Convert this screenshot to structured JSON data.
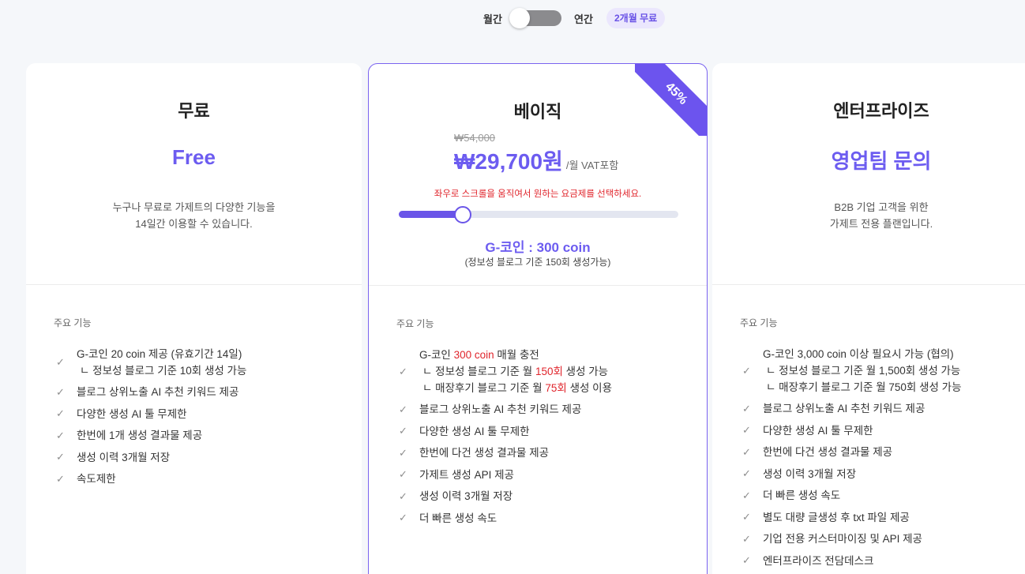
{
  "toggle": {
    "monthly_label": "월간",
    "yearly_label": "연간",
    "badge": "2개월 무료"
  },
  "plans": {
    "free": {
      "name": "무료",
      "price": "Free",
      "desc_line1": "누구나 무료로 가제트의 다양한 기능을",
      "desc_line2": "14일간 이용할 수 있습니다.",
      "features_title": "주요 기능",
      "features": [
        {
          "line1": "G-코인 20 coin 제공 (유효기간 14일)",
          "line2": "ㄴ 정보성 블로그 기준 10회 생성 가능"
        },
        {
          "text": "블로그 상위노출 AI 추천 키워드 제공"
        },
        {
          "text": "다양한 생성 AI 툴 무제한"
        },
        {
          "text": "한번에 1개 생성 결과물 제공"
        },
        {
          "text": "생성 이력 3개월 저장"
        },
        {
          "text": "속도제한"
        }
      ]
    },
    "basic": {
      "name": "베이직",
      "discount": "45%",
      "original_price": "₩54,000",
      "price": "₩29,700원",
      "unit": "/월 VAT포함",
      "hint": "좌우로 스크롤을 움직여서 원하는 요금제를 선택하세요.",
      "slider_fraction": 0.23,
      "coin": "G-코인 : 300 coin",
      "coin_sub": "(정보성 블로그 기준 150회 생성가능)",
      "features_title": "주요 기능",
      "feature1": {
        "a1": "G-코인 ",
        "a2": "300 coin",
        "a3": " 매월 충전",
        "b1": "ㄴ 정보성 블로그 기준 월 ",
        "b2": "150회",
        "b3": " 생성 가능",
        "c1": "ㄴ 매장후기 블로그 기준 월 ",
        "c2": "75회",
        "c3": " 생성 이용"
      },
      "features": [
        {
          "text": "블로그 상위노출 AI 추천 키워드 제공"
        },
        {
          "text": "다양한 생성 AI 툴 무제한"
        },
        {
          "text": "한번에 다건 생성 결과물 제공"
        },
        {
          "text": "가제트 생성 API 제공"
        },
        {
          "text": "생성 이력 3개월 저장"
        },
        {
          "text": "더 빠른 생성 속도"
        }
      ]
    },
    "enterprise": {
      "name": "엔터프라이즈",
      "price": "영업팀 문의",
      "desc_line1": "B2B 기업 고객을 위한",
      "desc_line2": "가제트 전용 플랜입니다.",
      "features_title": "주요 기능",
      "feature1": {
        "l1": "G-코인 3,000 coin 이상 필요시 가능 (협의)",
        "l2": "ㄴ 정보성 블로그 기준 월 1,500회 생성 가능",
        "l3": "ㄴ 매장후기 블로그 기준 월 750회 생성 가능"
      },
      "features": [
        {
          "text": "블로그 상위노출 AI 추천 키워드 제공"
        },
        {
          "text": "다양한 생성 AI 툴 무제한"
        },
        {
          "text": "한번에 다건 생성 결과물 제공"
        },
        {
          "text": "생성 이력 3개월 저장"
        },
        {
          "text": "더 빠른 생성 속도"
        },
        {
          "text": "별도 대량 글생성 후 txt 파일 제공"
        },
        {
          "text": "기업 전용 커스터마이징 및 API 제공"
        },
        {
          "text": "엔터프라이즈 전담데스크"
        }
      ]
    }
  },
  "icons": {
    "check": "check-icon"
  },
  "colors": {
    "accent": "#6c5cf0",
    "highlight": "#e0252c"
  }
}
